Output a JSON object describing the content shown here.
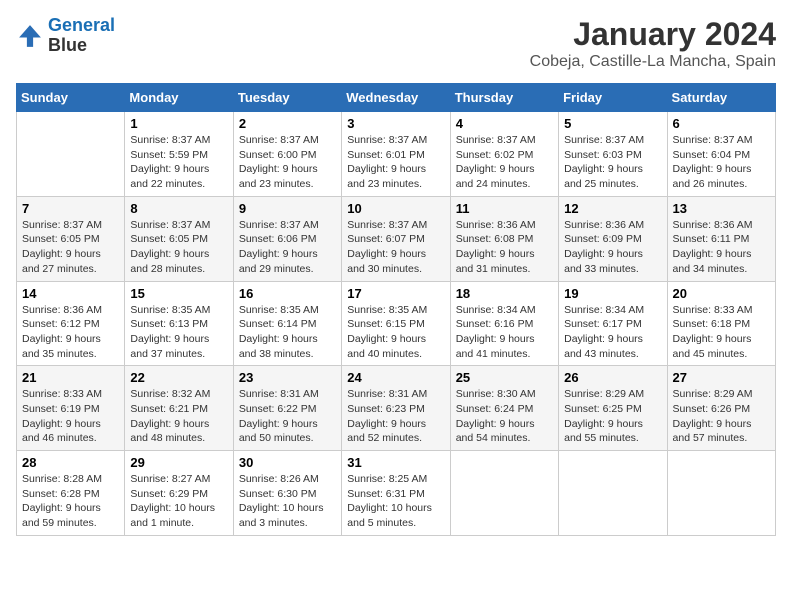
{
  "logo": {
    "line1": "General",
    "line2": "Blue"
  },
  "title": "January 2024",
  "subtitle": "Cobeja, Castille-La Mancha, Spain",
  "weekdays": [
    "Sunday",
    "Monday",
    "Tuesday",
    "Wednesday",
    "Thursday",
    "Friday",
    "Saturday"
  ],
  "weeks": [
    [
      {
        "day": "",
        "sunrise": "",
        "sunset": "",
        "daylight": ""
      },
      {
        "day": "1",
        "sunrise": "Sunrise: 8:37 AM",
        "sunset": "Sunset: 5:59 PM",
        "daylight": "Daylight: 9 hours and 22 minutes."
      },
      {
        "day": "2",
        "sunrise": "Sunrise: 8:37 AM",
        "sunset": "Sunset: 6:00 PM",
        "daylight": "Daylight: 9 hours and 23 minutes."
      },
      {
        "day": "3",
        "sunrise": "Sunrise: 8:37 AM",
        "sunset": "Sunset: 6:01 PM",
        "daylight": "Daylight: 9 hours and 23 minutes."
      },
      {
        "day": "4",
        "sunrise": "Sunrise: 8:37 AM",
        "sunset": "Sunset: 6:02 PM",
        "daylight": "Daylight: 9 hours and 24 minutes."
      },
      {
        "day": "5",
        "sunrise": "Sunrise: 8:37 AM",
        "sunset": "Sunset: 6:03 PM",
        "daylight": "Daylight: 9 hours and 25 minutes."
      },
      {
        "day": "6",
        "sunrise": "Sunrise: 8:37 AM",
        "sunset": "Sunset: 6:04 PM",
        "daylight": "Daylight: 9 hours and 26 minutes."
      }
    ],
    [
      {
        "day": "7",
        "sunrise": "Sunrise: 8:37 AM",
        "sunset": "Sunset: 6:05 PM",
        "daylight": "Daylight: 9 hours and 27 minutes."
      },
      {
        "day": "8",
        "sunrise": "Sunrise: 8:37 AM",
        "sunset": "Sunset: 6:05 PM",
        "daylight": "Daylight: 9 hours and 28 minutes."
      },
      {
        "day": "9",
        "sunrise": "Sunrise: 8:37 AM",
        "sunset": "Sunset: 6:06 PM",
        "daylight": "Daylight: 9 hours and 29 minutes."
      },
      {
        "day": "10",
        "sunrise": "Sunrise: 8:37 AM",
        "sunset": "Sunset: 6:07 PM",
        "daylight": "Daylight: 9 hours and 30 minutes."
      },
      {
        "day": "11",
        "sunrise": "Sunrise: 8:36 AM",
        "sunset": "Sunset: 6:08 PM",
        "daylight": "Daylight: 9 hours and 31 minutes."
      },
      {
        "day": "12",
        "sunrise": "Sunrise: 8:36 AM",
        "sunset": "Sunset: 6:09 PM",
        "daylight": "Daylight: 9 hours and 33 minutes."
      },
      {
        "day": "13",
        "sunrise": "Sunrise: 8:36 AM",
        "sunset": "Sunset: 6:11 PM",
        "daylight": "Daylight: 9 hours and 34 minutes."
      }
    ],
    [
      {
        "day": "14",
        "sunrise": "Sunrise: 8:36 AM",
        "sunset": "Sunset: 6:12 PM",
        "daylight": "Daylight: 9 hours and 35 minutes."
      },
      {
        "day": "15",
        "sunrise": "Sunrise: 8:35 AM",
        "sunset": "Sunset: 6:13 PM",
        "daylight": "Daylight: 9 hours and 37 minutes."
      },
      {
        "day": "16",
        "sunrise": "Sunrise: 8:35 AM",
        "sunset": "Sunset: 6:14 PM",
        "daylight": "Daylight: 9 hours and 38 minutes."
      },
      {
        "day": "17",
        "sunrise": "Sunrise: 8:35 AM",
        "sunset": "Sunset: 6:15 PM",
        "daylight": "Daylight: 9 hours and 40 minutes."
      },
      {
        "day": "18",
        "sunrise": "Sunrise: 8:34 AM",
        "sunset": "Sunset: 6:16 PM",
        "daylight": "Daylight: 9 hours and 41 minutes."
      },
      {
        "day": "19",
        "sunrise": "Sunrise: 8:34 AM",
        "sunset": "Sunset: 6:17 PM",
        "daylight": "Daylight: 9 hours and 43 minutes."
      },
      {
        "day": "20",
        "sunrise": "Sunrise: 8:33 AM",
        "sunset": "Sunset: 6:18 PM",
        "daylight": "Daylight: 9 hours and 45 minutes."
      }
    ],
    [
      {
        "day": "21",
        "sunrise": "Sunrise: 8:33 AM",
        "sunset": "Sunset: 6:19 PM",
        "daylight": "Daylight: 9 hours and 46 minutes."
      },
      {
        "day": "22",
        "sunrise": "Sunrise: 8:32 AM",
        "sunset": "Sunset: 6:21 PM",
        "daylight": "Daylight: 9 hours and 48 minutes."
      },
      {
        "day": "23",
        "sunrise": "Sunrise: 8:31 AM",
        "sunset": "Sunset: 6:22 PM",
        "daylight": "Daylight: 9 hours and 50 minutes."
      },
      {
        "day": "24",
        "sunrise": "Sunrise: 8:31 AM",
        "sunset": "Sunset: 6:23 PM",
        "daylight": "Daylight: 9 hours and 52 minutes."
      },
      {
        "day": "25",
        "sunrise": "Sunrise: 8:30 AM",
        "sunset": "Sunset: 6:24 PM",
        "daylight": "Daylight: 9 hours and 54 minutes."
      },
      {
        "day": "26",
        "sunrise": "Sunrise: 8:29 AM",
        "sunset": "Sunset: 6:25 PM",
        "daylight": "Daylight: 9 hours and 55 minutes."
      },
      {
        "day": "27",
        "sunrise": "Sunrise: 8:29 AM",
        "sunset": "Sunset: 6:26 PM",
        "daylight": "Daylight: 9 hours and 57 minutes."
      }
    ],
    [
      {
        "day": "28",
        "sunrise": "Sunrise: 8:28 AM",
        "sunset": "Sunset: 6:28 PM",
        "daylight": "Daylight: 9 hours and 59 minutes."
      },
      {
        "day": "29",
        "sunrise": "Sunrise: 8:27 AM",
        "sunset": "Sunset: 6:29 PM",
        "daylight": "Daylight: 10 hours and 1 minute."
      },
      {
        "day": "30",
        "sunrise": "Sunrise: 8:26 AM",
        "sunset": "Sunset: 6:30 PM",
        "daylight": "Daylight: 10 hours and 3 minutes."
      },
      {
        "day": "31",
        "sunrise": "Sunrise: 8:25 AM",
        "sunset": "Sunset: 6:31 PM",
        "daylight": "Daylight: 10 hours and 5 minutes."
      },
      {
        "day": "",
        "sunrise": "",
        "sunset": "",
        "daylight": ""
      },
      {
        "day": "",
        "sunrise": "",
        "sunset": "",
        "daylight": ""
      },
      {
        "day": "",
        "sunrise": "",
        "sunset": "",
        "daylight": ""
      }
    ]
  ]
}
